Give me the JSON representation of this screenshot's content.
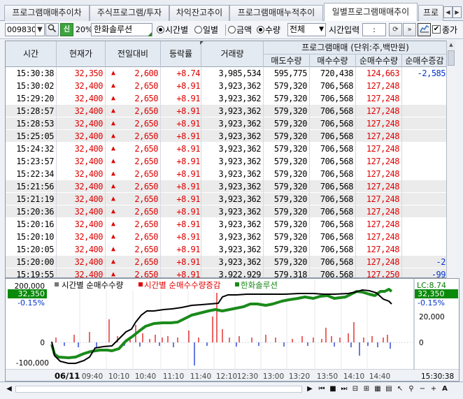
{
  "tabs": [
    "프로그램매매추이차",
    "주식프로그램/투자",
    "차익잔고추이",
    "프로그램매매누적추이",
    "일별프로그램매매추이",
    "프로"
  ],
  "active_tab": 4,
  "toolbar": {
    "code": "009830",
    "badge": "신",
    "pct": "20%",
    "name": "한화솔루션",
    "radio_time": "시간별",
    "radio_day": "일별",
    "radio_amount": "금액",
    "radio_qty": "수량",
    "select_all": "전체",
    "time_input_label": "시간입력",
    "time_input_value": ":",
    "cumulative_label": "종가"
  },
  "table": {
    "headers": {
      "time": "시간",
      "price": "현재가",
      "change": "전일대비",
      "rate": "등락률",
      "volume": "거래량",
      "program_group": "프로그램매매 (단위:주,백만원)",
      "sell": "매도수량",
      "buy": "매수수량",
      "net": "순매수수량",
      "net_chg": "순매수증감"
    },
    "rows": [
      [
        "15:30:38",
        "32,350",
        "2,600",
        "+8.74",
        "3,985,534",
        "595,775",
        "720,438",
        "124,663",
        "-2,585"
      ],
      [
        "15:30:02",
        "32,400",
        "2,650",
        "+8.91",
        "3,923,362",
        "579,320",
        "706,568",
        "127,248",
        ""
      ],
      [
        "15:29:20",
        "32,400",
        "2,650",
        "+8.91",
        "3,923,362",
        "579,320",
        "706,568",
        "127,248",
        ""
      ],
      [
        "15:28:57",
        "32,400",
        "2,650",
        "+8.91",
        "3,923,362",
        "579,320",
        "706,568",
        "127,248",
        ""
      ],
      [
        "15:28:53",
        "32,400",
        "2,650",
        "+8.91",
        "3,923,362",
        "579,320",
        "706,568",
        "127,248",
        ""
      ],
      [
        "15:25:05",
        "32,400",
        "2,650",
        "+8.91",
        "3,923,362",
        "579,320",
        "706,568",
        "127,248",
        ""
      ],
      [
        "15:24:32",
        "32,400",
        "2,650",
        "+8.91",
        "3,923,362",
        "579,320",
        "706,568",
        "127,248",
        ""
      ],
      [
        "15:23:57",
        "32,400",
        "2,650",
        "+8.91",
        "3,923,362",
        "579,320",
        "706,568",
        "127,248",
        ""
      ],
      [
        "15:22:34",
        "32,400",
        "2,650",
        "+8.91",
        "3,923,362",
        "579,320",
        "706,568",
        "127,248",
        ""
      ],
      [
        "15:21:56",
        "32,400",
        "2,650",
        "+8.91",
        "3,923,362",
        "579,320",
        "706,568",
        "127,248",
        ""
      ],
      [
        "15:21:19",
        "32,400",
        "2,650",
        "+8.91",
        "3,923,362",
        "579,320",
        "706,568",
        "127,248",
        ""
      ],
      [
        "15:20:36",
        "32,400",
        "2,650",
        "+8.91",
        "3,923,362",
        "579,320",
        "706,568",
        "127,248",
        ""
      ],
      [
        "15:20:16",
        "32,400",
        "2,650",
        "+8.91",
        "3,923,362",
        "579,320",
        "706,568",
        "127,248",
        ""
      ],
      [
        "15:20:10",
        "32,400",
        "2,650",
        "+8.91",
        "3,923,362",
        "579,320",
        "706,568",
        "127,248",
        ""
      ],
      [
        "15:20:05",
        "32,400",
        "2,650",
        "+8.91",
        "3,923,362",
        "579,320",
        "706,568",
        "127,248",
        ""
      ],
      [
        "15:20:00",
        "32,400",
        "2,650",
        "+8.91",
        "3,923,362",
        "579,320",
        "706,568",
        "127,248",
        "-2"
      ],
      [
        "15:19:55",
        "32,400",
        "2,650",
        "+8.91",
        "3,922,929",
        "579,318",
        "706,568",
        "127,250",
        "-99"
      ]
    ]
  },
  "chart": {
    "legend_time": "시간별 순매수수량",
    "legend_chg": "시간별 순매수수량증감",
    "legend_name": "한화솔루션",
    "left_ticks": [
      "200,000",
      "0",
      "-100,000"
    ],
    "right_ticks": [
      "20,000",
      "0"
    ],
    "price_left": "32,350",
    "pct_left": "-0.15%",
    "lc_label": "LC:8.74",
    "price_right": "32,350",
    "pct_right": "-0.15%",
    "date": "06/11",
    "x_ticks": [
      "09:40",
      "10:10",
      "10:40",
      "11:10",
      "11:40",
      "12:10",
      "12:30",
      "13:00",
      "13:20",
      "13:50",
      "14:10",
      "14:40"
    ],
    "end_time": "15:30:38",
    "colors": {
      "net": "#000000",
      "price": "#1a8a1a",
      "chg_pos": "#e00000",
      "chg_neg": "#0022cc"
    }
  }
}
